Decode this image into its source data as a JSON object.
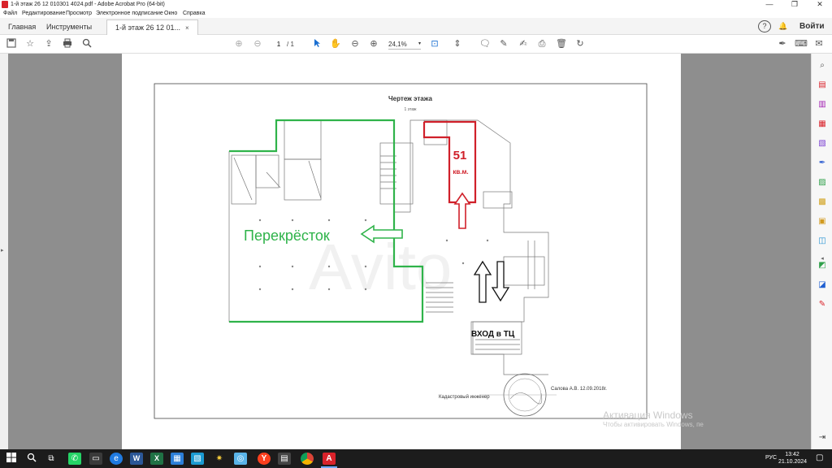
{
  "window": {
    "title": "1-й этаж 26 12 010301 4024.pdf - Adobe Acrobat Pro (64-bit)",
    "minimize": "—",
    "restore": "❐",
    "close": "✕"
  },
  "menu": {
    "items": [
      "Файл",
      "Редактирование",
      "Просмотр",
      "Электронное подписание",
      "Окно",
      "Справка"
    ]
  },
  "tabs": {
    "home": "Главная",
    "tools": "Инструменты",
    "document": "1-й этаж 26 12 01...",
    "close": "×"
  },
  "header": {
    "help_icon": "?",
    "bell_icon": "🔔",
    "sign_in": "Войти"
  },
  "toolbar": {
    "page_current": "1",
    "page_total": "/ 1",
    "zoom": "24,1%",
    "zoom_caret": "▾"
  },
  "floorplan": {
    "title": "Чертеж этажа",
    "subtitle": "1 этаж",
    "area_number": "51",
    "area_unit": "кв.м.",
    "store_label": "Перекрёсток",
    "entrance_label": "ВХОД в ТЦ",
    "engineer_label": "Кадастровый инженер",
    "engineer_sign": "Салова А.В. 12.09.2018г."
  },
  "watermark": {
    "line1": "Активация Windows",
    "line2": "Чтобы активировать Windows, пе"
  },
  "taskbar": {
    "lang": "РУС",
    "time": "13:42",
    "date": "21.10.2024"
  },
  "colors": {
    "green_outline": "#2fb34a",
    "red_outline": "#d0202a",
    "acrobat_red": "#d9222a",
    "accent_blue": "#1a6fd1"
  }
}
